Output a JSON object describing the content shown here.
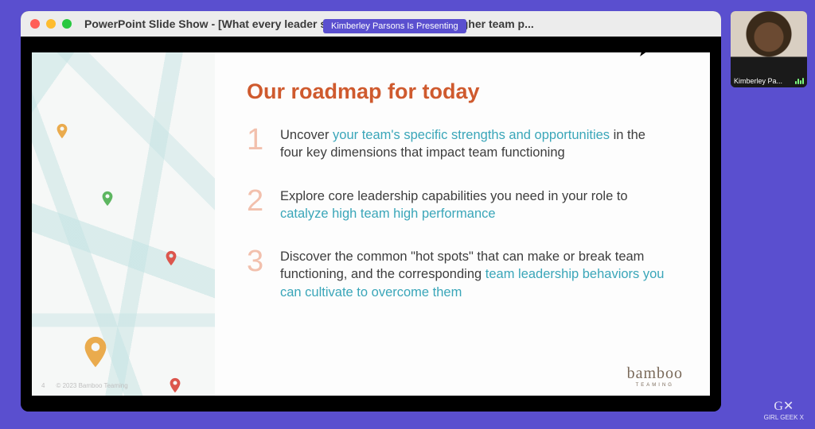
{
  "window": {
    "title": "PowerPoint Slide Show - [What every leader should know to catalyze higher team p..."
  },
  "presenter_pill": "Kimberley Parsons Is Presenting",
  "slide": {
    "title": "Our roadmap for today",
    "items": [
      {
        "num": "1",
        "pre": "Uncover ",
        "hl": "your team's specific strengths and opportunities",
        "post": " in the four key dimensions that impact team functioning"
      },
      {
        "num": "2",
        "pre": "Explore core leadership capabilities you need in your role to ",
        "hl": "catalyze high team high performance",
        "post": ""
      },
      {
        "num": "3",
        "pre": "Discover the common \"hot spots\" that can make or break team functioning, and the corresponding ",
        "hl": "team leadership behaviors you can cultivate to overcome them",
        "post": ""
      }
    ],
    "page_number": "4",
    "copyright": "© 2023 Bamboo Teaming",
    "brand_main": "bamboo",
    "brand_sub": "TEAMING"
  },
  "camera": {
    "name": "Kimberley Pa..."
  },
  "watermark": {
    "logo": "G✕",
    "label": "GIRL GEEK X"
  },
  "colors": {
    "accent_title": "#cf5a2e",
    "highlight": "#3aa6b9",
    "bg": "#5a4fcf"
  }
}
